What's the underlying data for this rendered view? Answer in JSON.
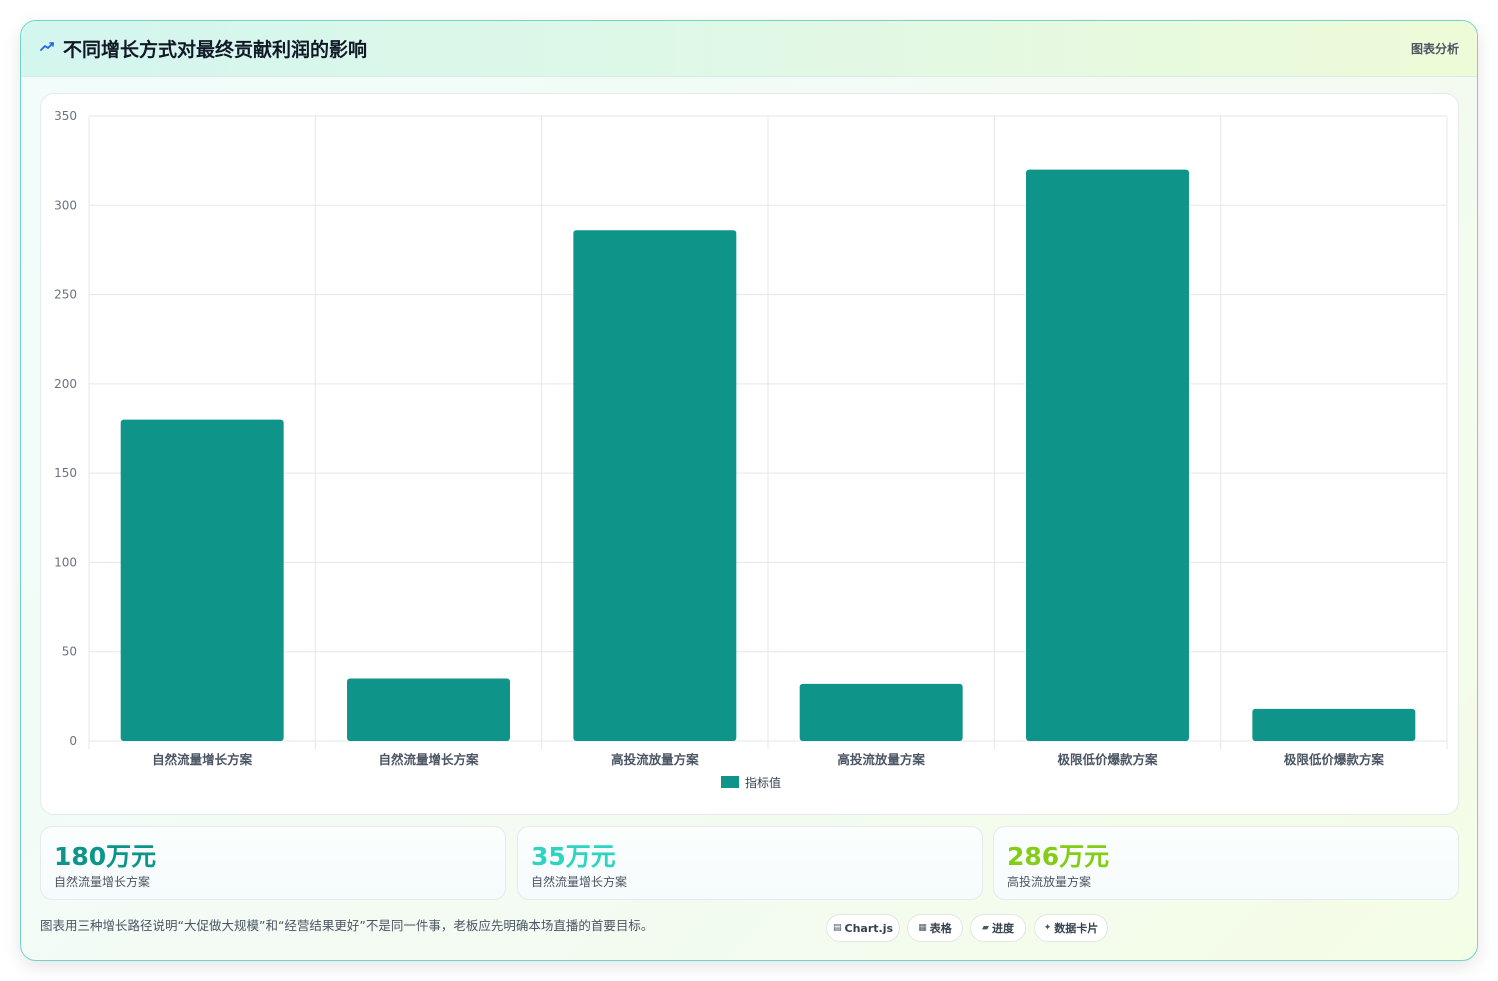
{
  "header": {
    "title": "不同增长方式对最终贡献利润的影响",
    "right_label": "图表分析"
  },
  "chart_data": {
    "type": "bar",
    "categories": [
      "自然流量增长方案",
      "自然流量增长方案",
      "高投流放量方案",
      "高投流放量方案",
      "极限低价爆款方案",
      "极限低价爆款方案"
    ],
    "series": [
      {
        "name": "指标值",
        "values": [
          180,
          35,
          286,
          32,
          320,
          18
        ],
        "color": "#0e9488"
      }
    ],
    "yticks": [
      0,
      50,
      100,
      150,
      200,
      250,
      300,
      350
    ],
    "ylim": [
      0,
      350
    ],
    "grid": true,
    "legend_position": "bottom"
  },
  "stats": [
    {
      "value": "180万元",
      "label": "自然流量增长方案",
      "color": "#0e9488"
    },
    {
      "value": "35万元",
      "label": "自然流量增长方案",
      "color": "#2dd4bf"
    },
    {
      "value": "286万元",
      "label": "高投流放量方案",
      "color": "#84cc16"
    }
  ],
  "footer": {
    "note": "图表用三种增长路径说明“大促做大规模”和“经营结果更好”不是同一件事，老板应先明确本场直播的首要目标。",
    "chips": [
      {
        "icon": "chart-icon",
        "label": "Chart.js"
      },
      {
        "icon": "table-icon",
        "label": "表格"
      },
      {
        "icon": "progress-icon",
        "label": "进度"
      },
      {
        "icon": "card-icon",
        "label": "数据卡片"
      }
    ]
  }
}
